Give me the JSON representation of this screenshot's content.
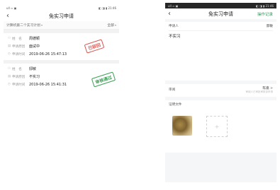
{
  "left": {
    "status": {
      "left": "ull ≈ ▣",
      "right": "◧ ◨ ▮ 21:46"
    },
    "title": "免实习申请",
    "filter": {
      "plan": "计算机第二个实习计划",
      "scope": "全部"
    },
    "records": [
      {
        "name_label": "姓　名",
        "name": "周德颖",
        "reason_label": "申请原因",
        "reason": "面试中",
        "time_label": "申请时间",
        "time": "2019-06-26 15:47:13",
        "stamp": "已驳回"
      },
      {
        "name_label": "姓　名",
        "name": "邸敏",
        "reason_label": "申请原因",
        "reason": "不实习",
        "time_label": "申请时间",
        "time": "2019-06-26 15:41:31",
        "stamp": "审核通过"
      }
    ]
  },
  "right": {
    "status": {
      "left": "ull ≈ ▣",
      "right": "◧ ◨ ▮ 21:46"
    },
    "title": "免实习申请",
    "record_link": "操作记录",
    "applicant_label": "申请人",
    "applicant": "邸敏",
    "reason_text": "不实习",
    "approver_label": "审阅",
    "approver": "陈嘉 >",
    "approver_hint": "审阅人已审批审核该申请",
    "attachment_label": "证明文件",
    "add_icon": "+"
  },
  "colors": {
    "reject": "#d9534f",
    "approve": "#3aa055",
    "link": "#2ba35d"
  }
}
